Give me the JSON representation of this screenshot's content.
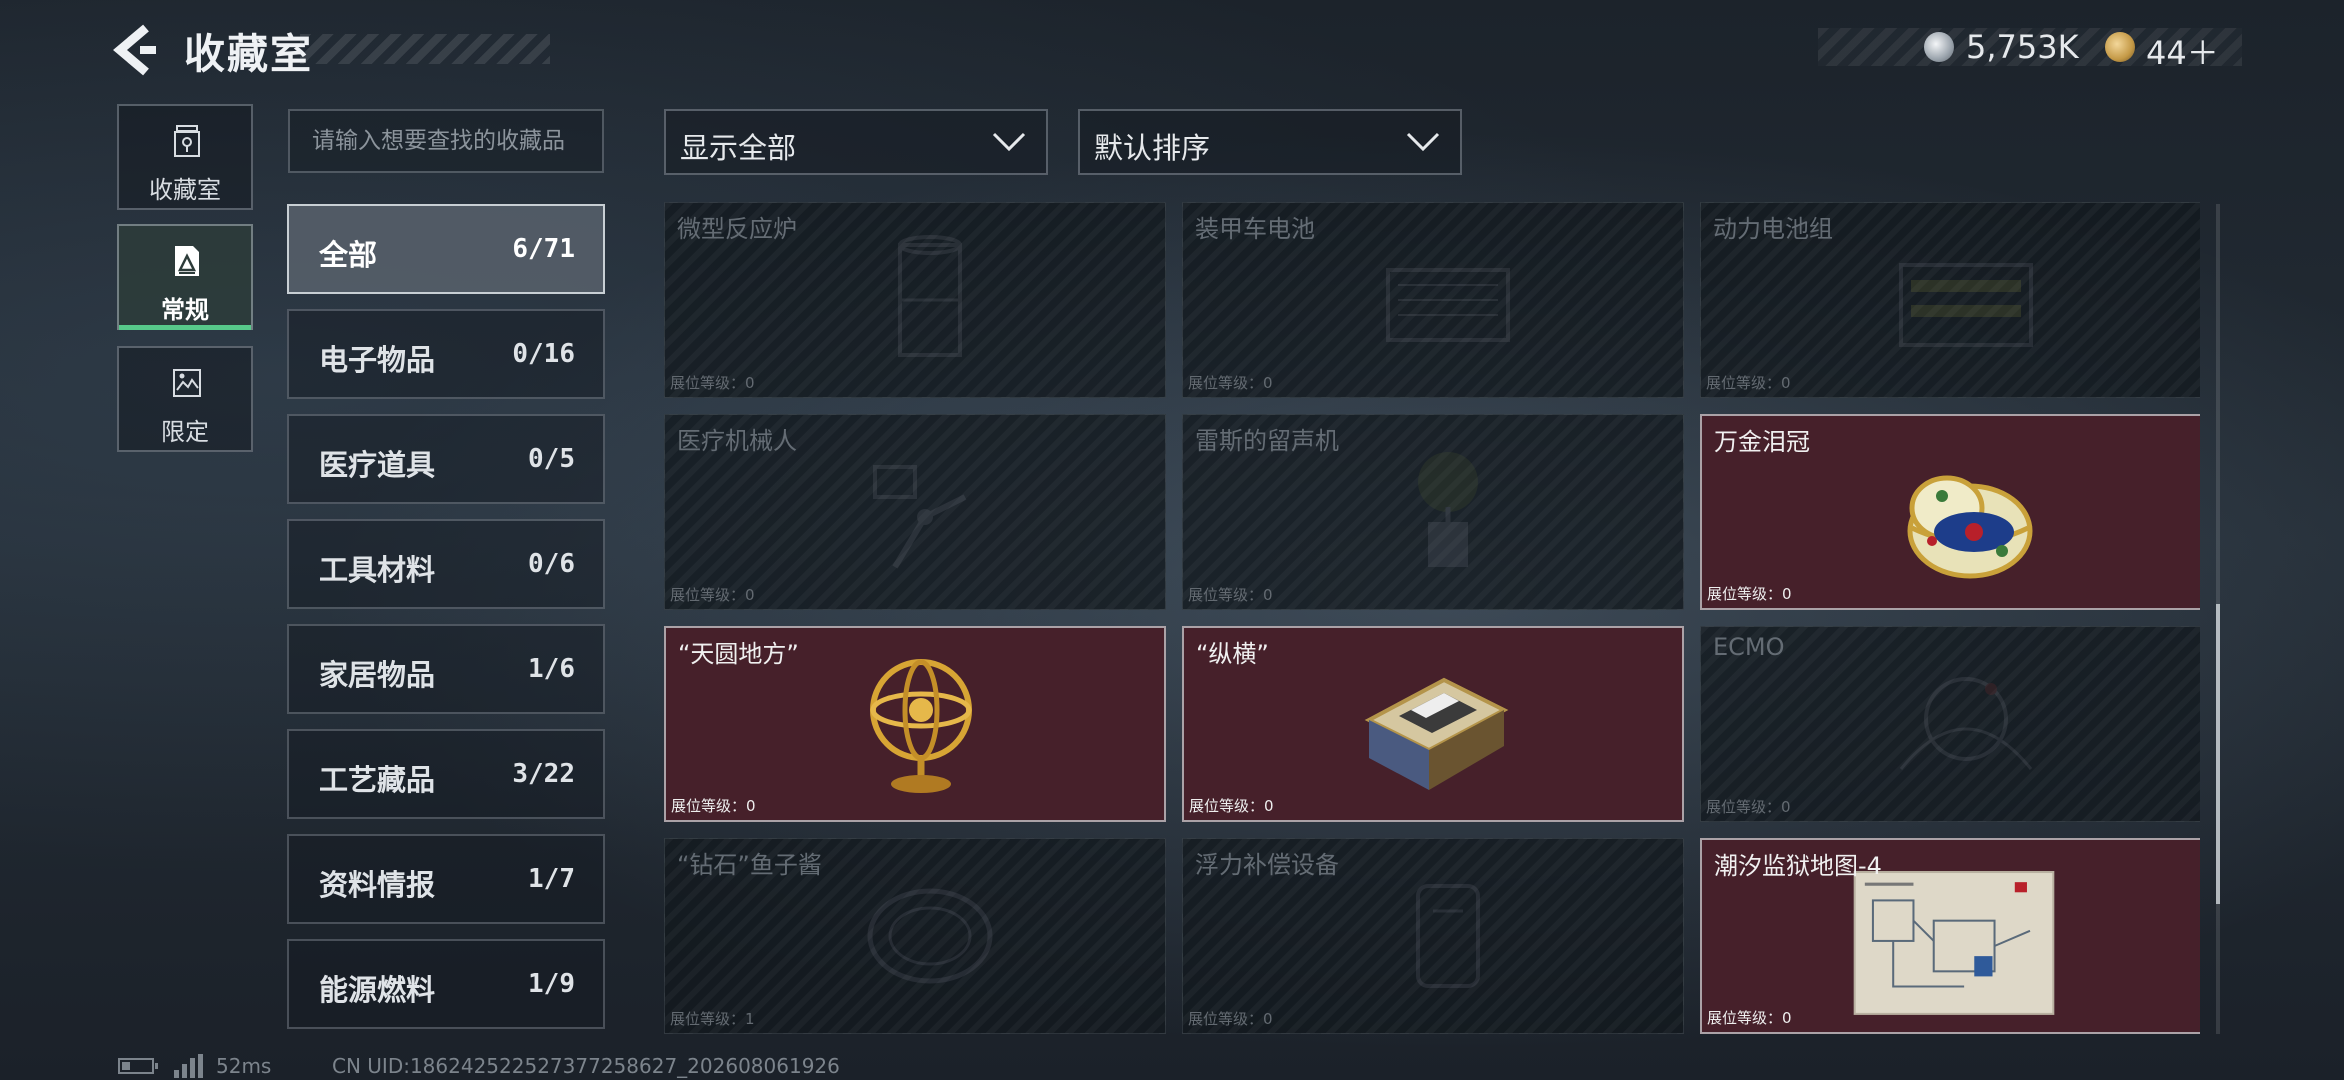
{
  "header": {
    "title": "收藏室",
    "currency": [
      {
        "icon": "silver-coin-icon",
        "value": "5,753K"
      },
      {
        "icon": "gold-token-icon",
        "value": "44＋"
      }
    ]
  },
  "side_tabs": [
    {
      "label": "收藏室",
      "icon": "collection-room-icon"
    },
    {
      "label": "常规",
      "icon": "regular-icon",
      "active": true
    },
    {
      "label": "限定",
      "icon": "limited-icon"
    }
  ],
  "search": {
    "placeholder": "请输入想要查找的收藏品",
    "value": ""
  },
  "filter": {
    "selected": "显示全部"
  },
  "sort": {
    "selected": "默认排序"
  },
  "categories": [
    {
      "name": "全部",
      "count": "6/71",
      "active": true
    },
    {
      "name": "电子物品",
      "count": "0/16"
    },
    {
      "name": "医疗道具",
      "count": "0/5"
    },
    {
      "name": "工具材料",
      "count": "0/6"
    },
    {
      "name": "家居物品",
      "count": "1/6"
    },
    {
      "name": "工艺藏品",
      "count": "3/22"
    },
    {
      "name": "资料情报",
      "count": "1/7"
    },
    {
      "name": "能源燃料",
      "count": "1/9"
    }
  ],
  "items": [
    {
      "name": "微型反应炉",
      "level": "展位等级：0",
      "owned": false,
      "icon": "reactor-icon"
    },
    {
      "name": "装甲车电池",
      "level": "展位等级：0",
      "owned": false,
      "icon": "battery-icon"
    },
    {
      "name": "动力电池组",
      "level": "展位等级：0",
      "owned": false,
      "icon": "battery-pack-icon"
    },
    {
      "name": "医疗机械人",
      "level": "展位等级：0",
      "owned": false,
      "icon": "robot-arm-icon"
    },
    {
      "name": "雷斯的留声机",
      "level": "展位等级：0",
      "owned": false,
      "icon": "gramophone-icon"
    },
    {
      "name": "万金泪冠",
      "level": "展位等级：0",
      "owned": true,
      "icon": "jeweled-egg-icon"
    },
    {
      "name": "“天圆地方”",
      "level": "展位等级：0",
      "owned": true,
      "icon": "armillary-sphere-icon"
    },
    {
      "name": "“纵横”",
      "level": "展位等级：0",
      "owned": true,
      "icon": "chess-box-icon"
    },
    {
      "name": "ECMO",
      "level": "展位等级：0",
      "owned": false,
      "icon": "ecmo-machine-icon"
    },
    {
      "name": "“钻石”鱼子酱",
      "level": "展位等级：1",
      "owned": false,
      "icon": "caviar-tin-icon"
    },
    {
      "name": "浮力补偿设备",
      "level": "展位等级：0",
      "owned": false,
      "icon": "buoyancy-device-icon"
    },
    {
      "name": "潮汐监狱地图-4",
      "level": "展位等级：0",
      "owned": true,
      "icon": "map-icon"
    }
  ],
  "footer": {
    "ping": "52ms",
    "uid": "CN UID:186242522527377258627_202608061926"
  },
  "colors": {
    "accent": "#57c98a",
    "owned_card": "#46202a",
    "locked_card": "#12181e"
  }
}
